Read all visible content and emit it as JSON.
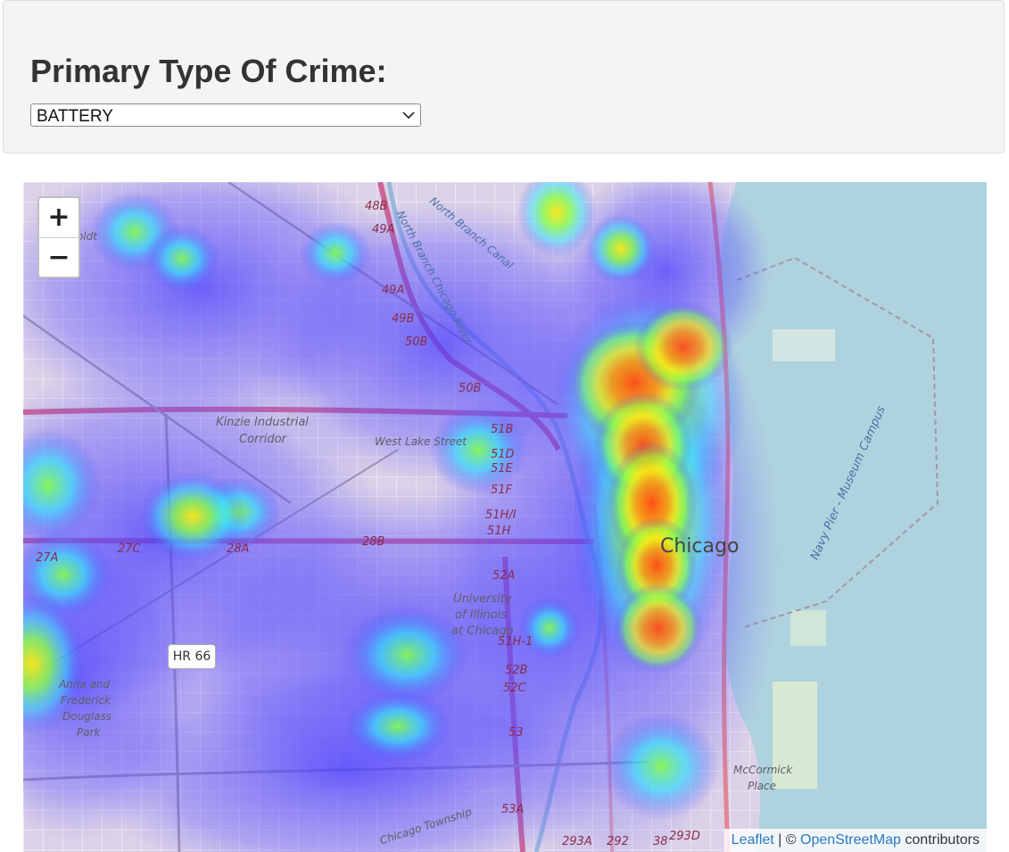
{
  "filter": {
    "title": "Primary Type Of Crime:",
    "selected_value": "BATTERY"
  },
  "map": {
    "zoom_in_label": "+",
    "zoom_out_label": "−",
    "attribution": {
      "leaflet": "Leaflet",
      "separator": " | © ",
      "osm": "OpenStreetMap",
      "suffix": " contributors"
    },
    "labels": {
      "kinzie": "Kinzie Industrial",
      "corridor": "Corridor",
      "west_lake": "West Lake Street",
      "chicago": "Chicago",
      "uic1": "University",
      "uic2": "of Illinois",
      "uic3": "at Chicago",
      "hr66": "HR 66",
      "park1": "Anna and",
      "park2": "Frederick",
      "park3": "Douglass",
      "park4": "Park",
      "mccormick1": "McCormick",
      "mccormick2": "Place",
      "navy_pier": "Navy Pier - Museum Campus",
      "nb_canal": "North Branch Canal",
      "nb_river": "North Branch Chicago River",
      "township": "Chicago Township",
      "oldt": "oldt",
      "exits": [
        "48B",
        "49A",
        "49A",
        "49B",
        "50B",
        "50B",
        "51B",
        "51D",
        "51E",
        "51F",
        "51H/I",
        "51H",
        "52A",
        "51H-1",
        "52B",
        "52C",
        "53",
        "53A",
        "293A",
        "292",
        "38",
        "293D",
        "27A",
        "27C",
        "28A",
        "28B"
      ]
    },
    "heatmap_colors": [
      "#3b30ff",
      "#00e5ff",
      "#7dff3a",
      "#ffe600",
      "#ff3a00"
    ]
  }
}
